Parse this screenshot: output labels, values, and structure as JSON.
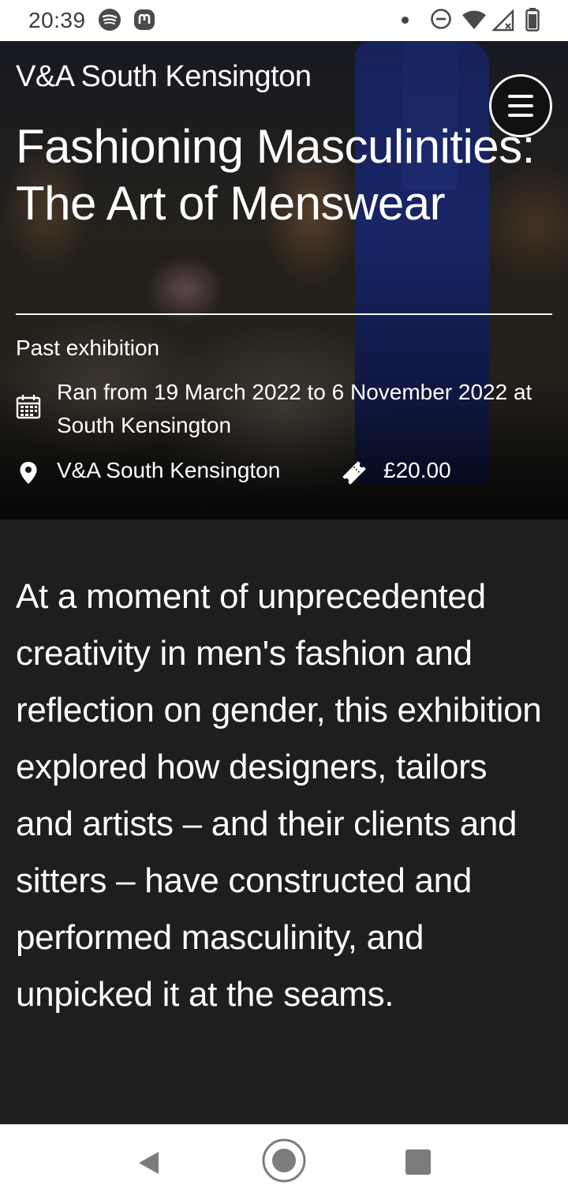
{
  "status_bar": {
    "time": "20:39",
    "icons": [
      "spotify-icon",
      "mastodon-icon",
      "notification-dot",
      "do-not-disturb-icon",
      "wifi-icon",
      "signal-icon",
      "battery-icon"
    ]
  },
  "header": {
    "site_title": "V&A South Kensington",
    "menu_icon": "hamburger-menu-icon"
  },
  "exhibition": {
    "title": "Fashioning Masculinities: The Art of Menswear",
    "status": "Past exhibition",
    "dates": "Ran from 19 March 2022 to 6 November 2022 at South Kensington",
    "location": "V&A South Kensington",
    "price": "£20.00",
    "description": "At a moment of unprecedented creativity in men's fashion and reflection on gender, this exhibition explored how designers, tailors and artists – and their clients and sitters – have constructed and performed masculinity, and unpicked it at the seams."
  },
  "nav_bar": {
    "buttons": [
      "back-icon",
      "home-icon",
      "recents-icon"
    ]
  },
  "colors": {
    "background": "#1e1e1e",
    "text": "#ffffff",
    "status_bar": "#ffffff"
  }
}
